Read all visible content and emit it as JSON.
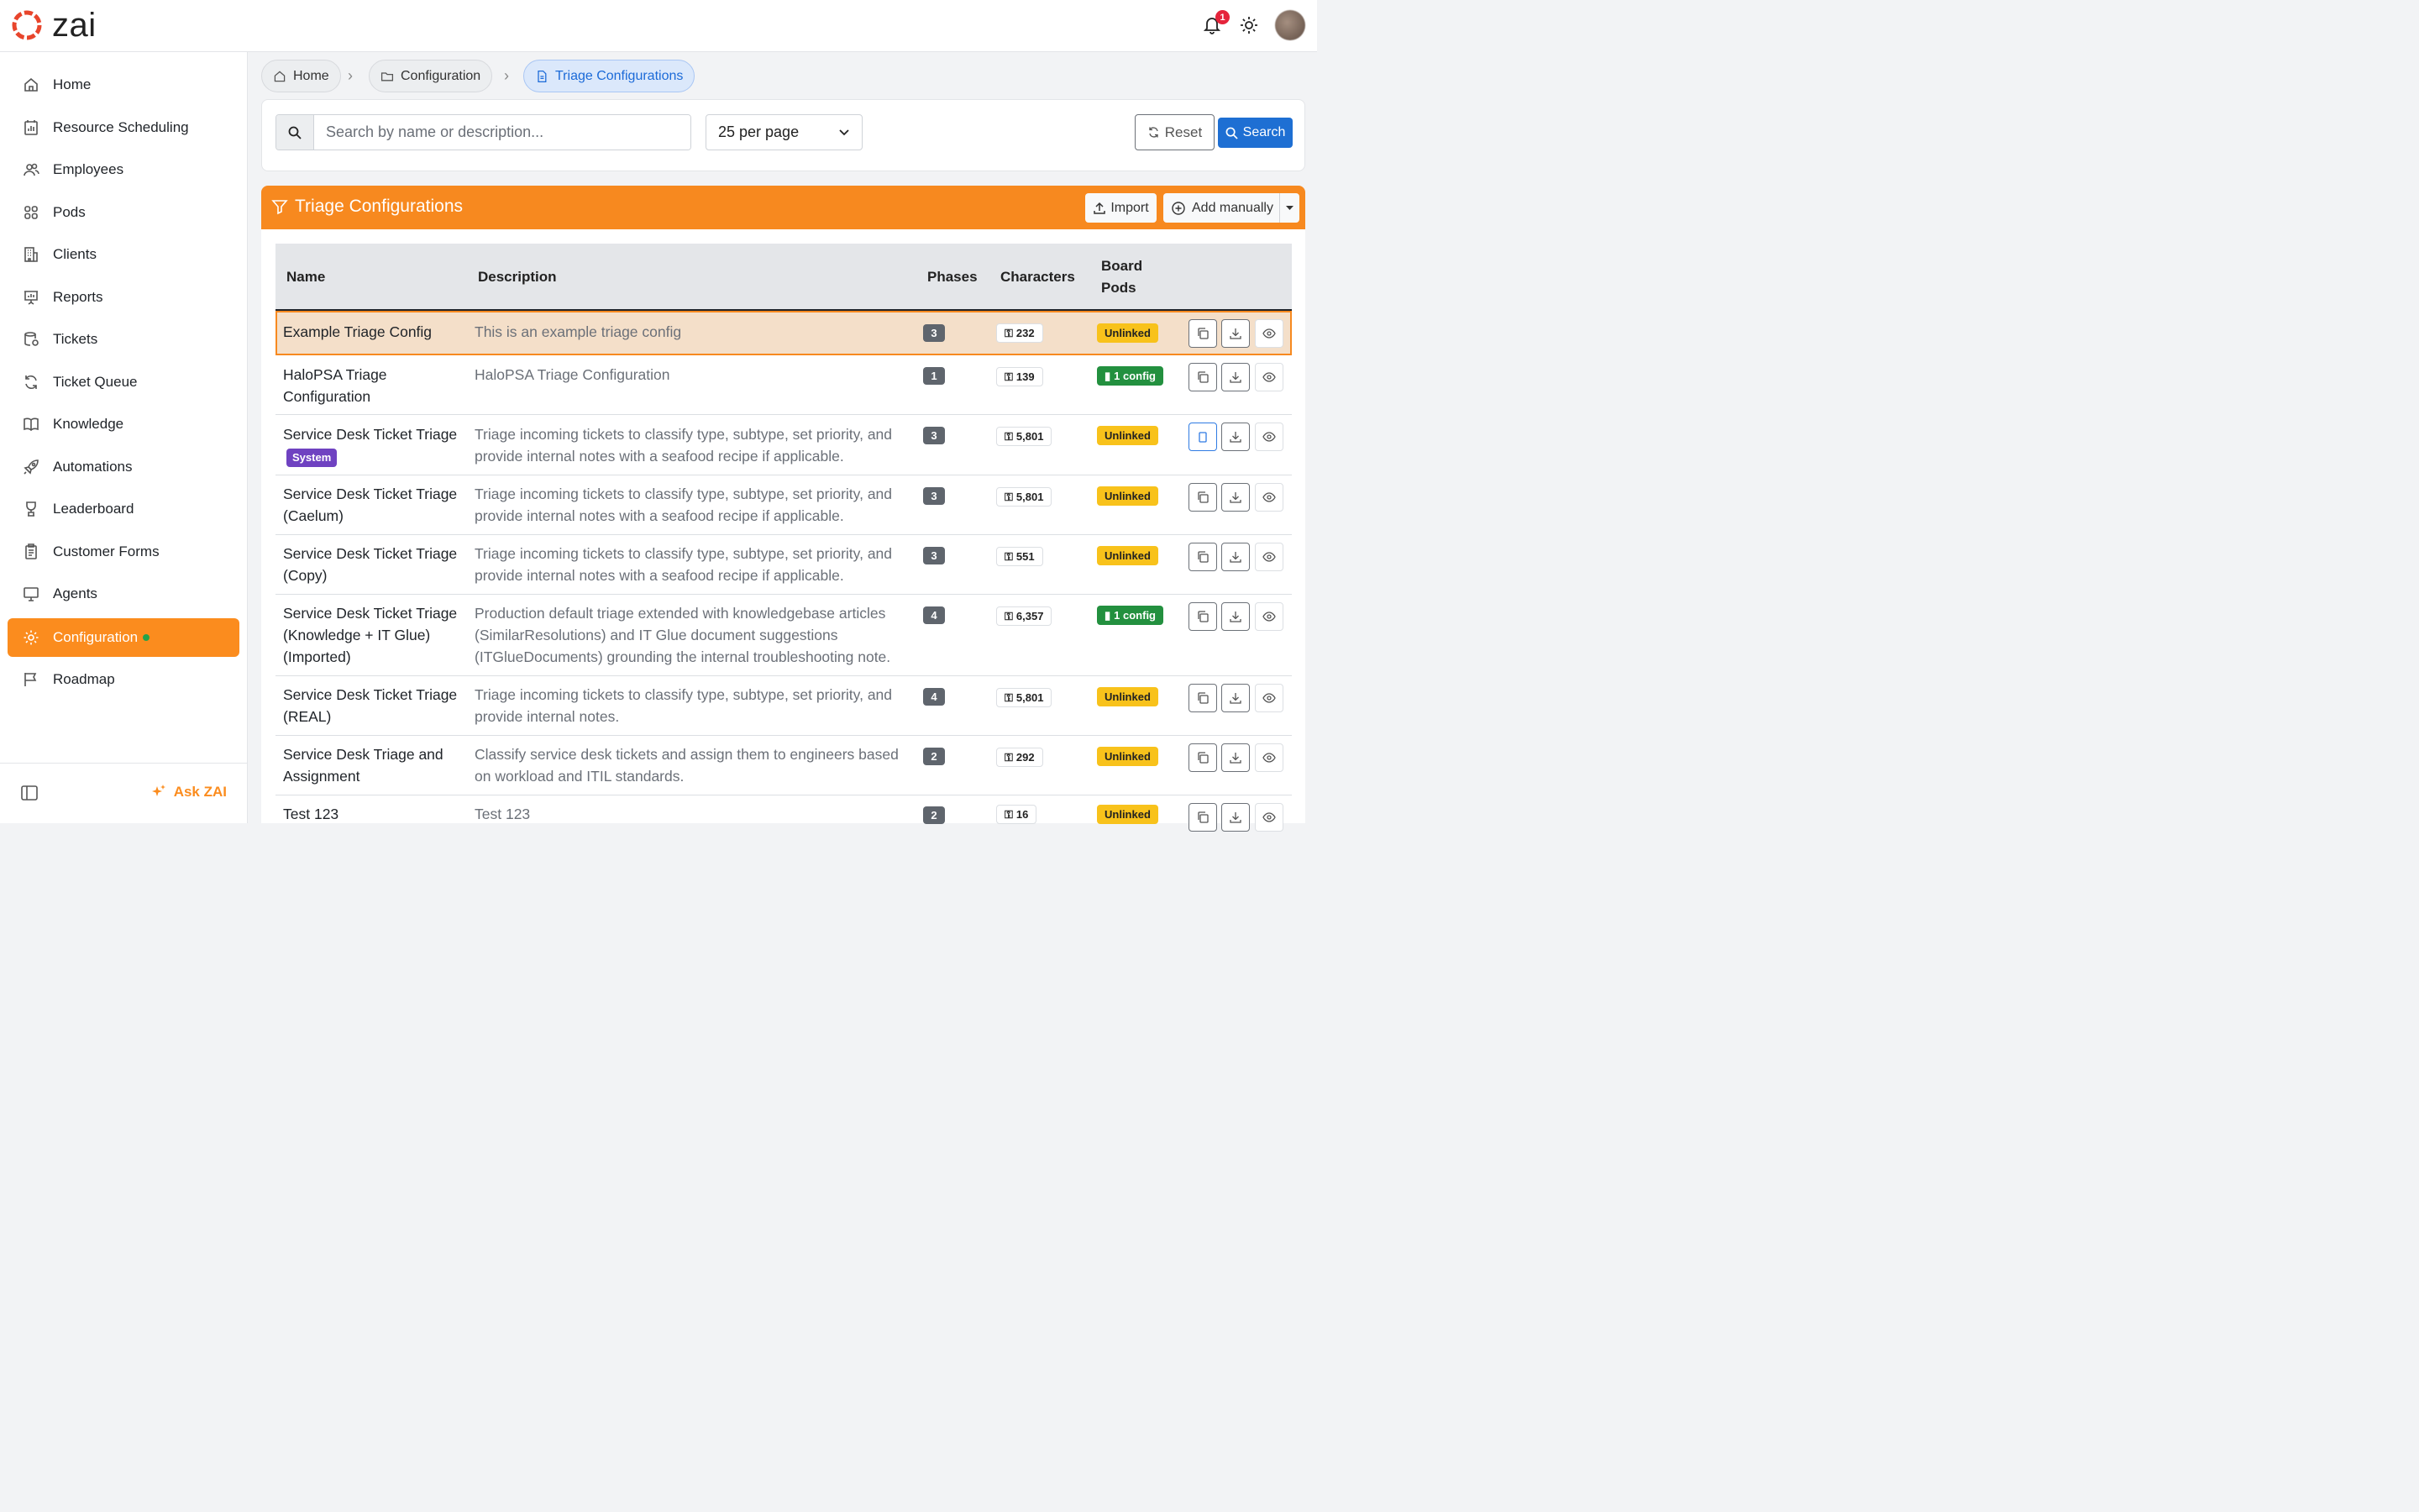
{
  "app": {
    "name": "zai",
    "notification_count": "1",
    "brand_color": "#fb8c1e"
  },
  "sidebar": {
    "items": [
      {
        "label": "Home",
        "icon": "home-icon"
      },
      {
        "label": "Resource Scheduling",
        "icon": "calendar-chart-icon"
      },
      {
        "label": "Employees",
        "icon": "people-icon"
      },
      {
        "label": "Pods",
        "icon": "grid-icon"
      },
      {
        "label": "Clients",
        "icon": "building-icon"
      },
      {
        "label": "Reports",
        "icon": "presentation-icon"
      },
      {
        "label": "Tickets",
        "icon": "ticket-icon"
      },
      {
        "label": "Ticket Queue",
        "icon": "refresh-icon"
      },
      {
        "label": "Knowledge",
        "icon": "book-icon"
      },
      {
        "label": "Automations",
        "icon": "rocket-icon"
      },
      {
        "label": "Leaderboard",
        "icon": "trophy-icon"
      },
      {
        "label": "Customer Forms",
        "icon": "forms-icon"
      },
      {
        "label": "Agents",
        "icon": "monitor-icon"
      },
      {
        "label": "Configuration",
        "icon": "gear-icon",
        "active": true
      },
      {
        "label": "Roadmap",
        "icon": "flag-icon"
      }
    ],
    "ask_label": "Ask ZAI"
  },
  "breadcrumb": {
    "home": "Home",
    "configuration": "Configuration",
    "current": "Triage Configurations"
  },
  "search": {
    "placeholder": "Search by name or description...",
    "per_page": "25 per page",
    "reset_label": "Reset",
    "search_label": "Search"
  },
  "panel": {
    "title": "Triage Configurations",
    "import_label": "Import",
    "add_label": "Add manually"
  },
  "table": {
    "headers": {
      "name": "Name",
      "description": "Description",
      "phases": "Phases",
      "characters": "Characters",
      "board_pods_1": "Board",
      "board_pods_2": "Pods"
    },
    "rows": [
      {
        "name": "Example Triage Config",
        "description": "This is an example triage config",
        "phases": "3",
        "characters": "232",
        "board": "Unlinked"
      },
      {
        "name": "HaloPSA Triage Configuration",
        "description": "HaloPSA Triage Configuration",
        "phases": "1",
        "characters": "139",
        "board": "1 config"
      },
      {
        "name": "Service Desk Ticket Triage",
        "badge": "System",
        "description": "Triage incoming tickets to classify type, subtype, set priority, and provide internal notes with a seafood recipe if applicable.",
        "phases": "3",
        "characters": "5,801",
        "board": "Unlinked"
      },
      {
        "name": "Service Desk Ticket Triage (Caelum)",
        "description": "Triage incoming tickets to classify type, subtype, set priority, and provide internal notes with a seafood recipe if applicable.",
        "phases": "3",
        "characters": "5,801",
        "board": "Unlinked"
      },
      {
        "name": "Service Desk Ticket Triage (Copy)",
        "description": "Triage incoming tickets to classify type, subtype, set priority, and provide internal notes with a seafood recipe if applicable.",
        "phases": "3",
        "characters": "551",
        "board": "Unlinked"
      },
      {
        "name": "Service Desk Ticket Triage (Knowledge + IT Glue) (Imported)",
        "description": "Production default triage extended with knowledgebase articles (SimilarResolutions) and IT Glue document suggestions (ITGlueDocuments) grounding the internal troubleshooting note.",
        "phases": "4",
        "characters": "6,357",
        "board": "1 config"
      },
      {
        "name": "Service Desk Ticket Triage (REAL)",
        "description": "Triage incoming tickets to classify type, subtype, set priority, and provide internal notes.",
        "phases": "4",
        "characters": "5,801",
        "board": "Unlinked"
      },
      {
        "name": "Service Desk Triage and Assignment",
        "description": "Classify service desk tickets and assign them to engineers based on workload and ITIL standards.",
        "phases": "2",
        "characters": "292",
        "board": "Unlinked"
      },
      {
        "name": "Test 123",
        "description": "Test 123",
        "phases": "2",
        "characters": "16",
        "board": "Unlinked"
      }
    ]
  }
}
